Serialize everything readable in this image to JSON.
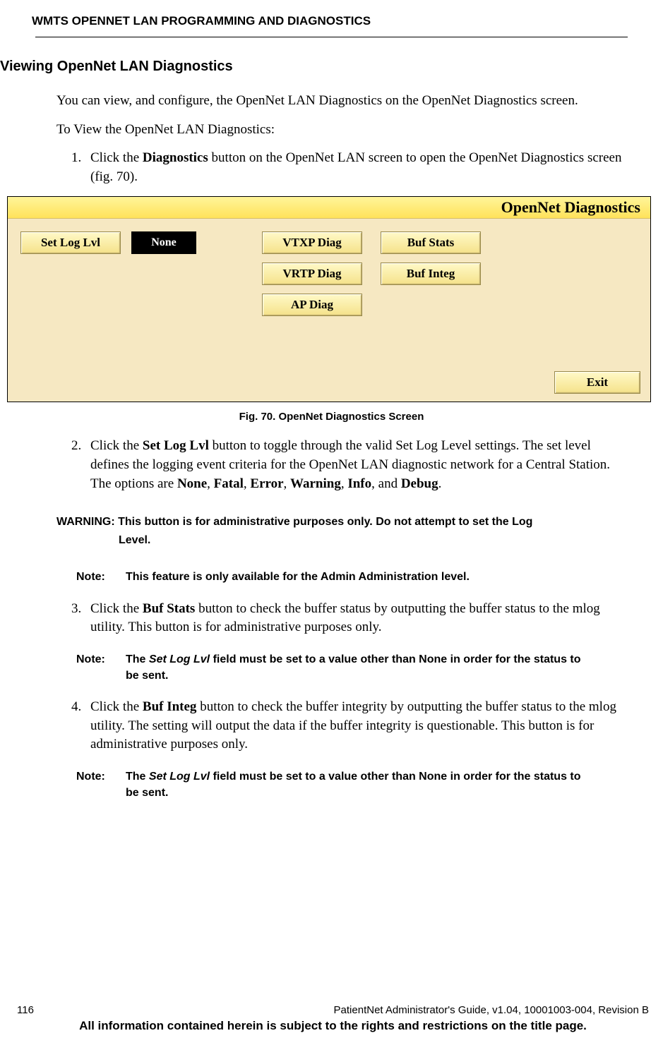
{
  "header": {
    "title": "WMTS OPENNET LAN PROGRAMMING AND DIAGNOSTICS"
  },
  "section": {
    "heading": "Viewing OpenNet LAN Diagnostics",
    "intro": "You can view, and configure, the OpenNet LAN Diagnostics on the OpenNet Diagnostics screen.",
    "subintro": "To View the OpenNet LAN Diagnostics:"
  },
  "steps": {
    "s1_pre": "Click the ",
    "s1_bold": "Diagnostics",
    "s1_post": " button on the OpenNet LAN screen to open the OpenNet Diagnostics screen (fig. 70).",
    "s2_pre": "Click the ",
    "s2_bold": "Set Log Lvl",
    "s2_mid": " button to toggle through the valid Set Log Level settings. The set level defines the logging event criteria for the OpenNet LAN diagnostic network for a Central Station. The options are ",
    "s2_opt1": "None",
    "s2_c1": ", ",
    "s2_opt2": "Fatal",
    "s2_c2": ", ",
    "s2_opt3": "Error",
    "s2_c3": ", ",
    "s2_opt4": "Warning",
    "s2_c4": ", ",
    "s2_opt5": "Info",
    "s2_c5": ", and ",
    "s2_opt6": "Debug",
    "s2_end": ".",
    "s3_pre": "Click the ",
    "s3_bold": "Buf Stats",
    "s3_post": " button to check the buffer status by outputting the buffer status to the mlog utility. This button is for administrative purposes only.",
    "s4_pre": "Click the ",
    "s4_bold": "Buf Integ",
    "s4_post": " button to check the buffer integrity by outputting the buffer status to the mlog utility. The setting will output the data if the buffer integrity is questionable. This button is for administrative purposes only."
  },
  "figure": {
    "titlebar": "OpenNet Diagnostics",
    "buttons": {
      "set_log_lvl": "Set Log Lvl",
      "none_value": "None",
      "vtxp": "VTXP Diag",
      "vrtp": "VRTP Diag",
      "ap": "AP Diag",
      "buf_stats": "Buf Stats",
      "buf_integ": "Buf Integ",
      "exit": "Exit"
    },
    "caption": "Fig. 70. OpenNet Diagnostics Screen"
  },
  "warning": {
    "label": "WARNING: ",
    "text_line1": "This button is for administrative purposes only. Do not attempt to set the Log",
    "text_line2": "Level."
  },
  "notes": {
    "label": "Note:",
    "n1": "This feature is only available for the Admin Administration level.",
    "n2_pre": "The ",
    "n2_italic": "Set Log Lvl",
    "n2_post": " field must be set to a value other than None in order for the status to be sent.",
    "n3_pre": "The ",
    "n3_italic": "Set Log Lvl",
    "n3_post": " field must be set to a value other than None in order for the status to be sent."
  },
  "footer": {
    "page_no": "116",
    "doc_info": "PatientNet Administrator's Guide, v1.04, 10001003-004, Revision B",
    "legal": "All information contained herein is subject to the rights and restrictions on the title page."
  }
}
